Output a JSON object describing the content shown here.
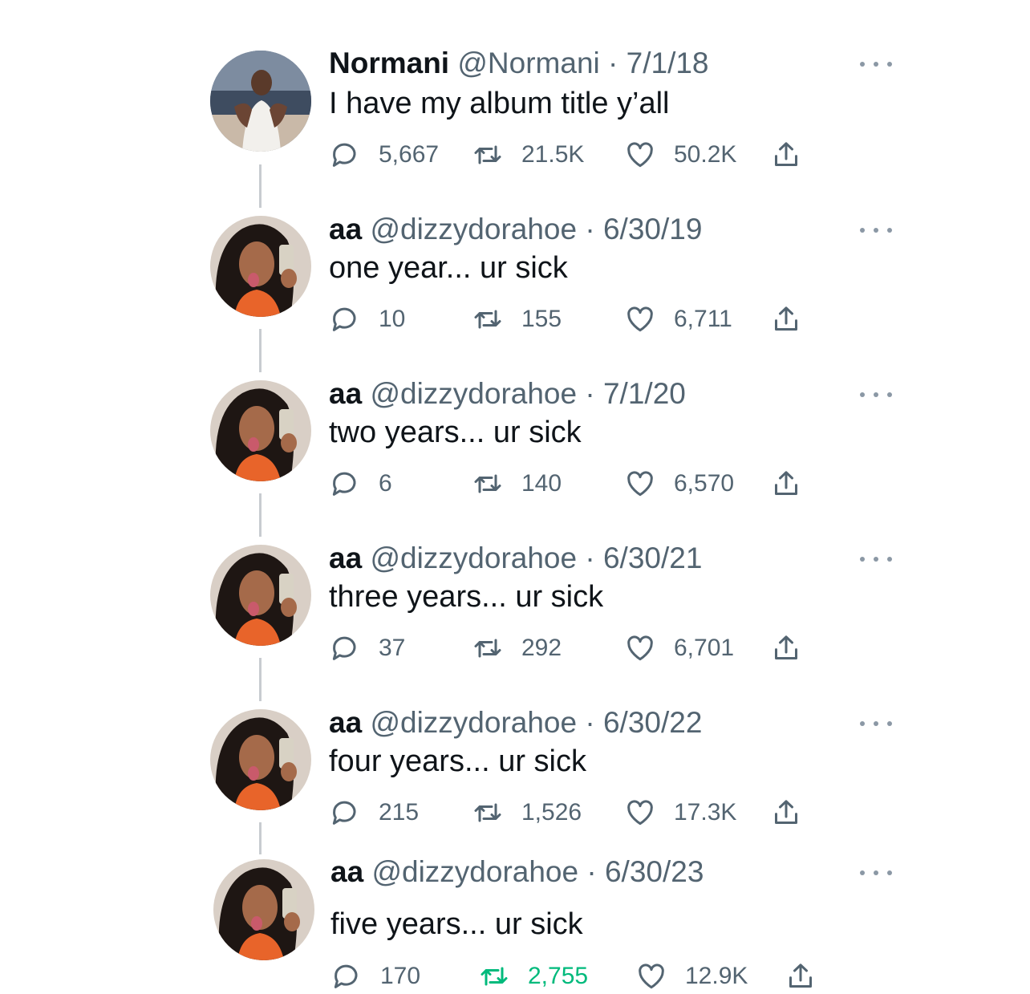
{
  "tweets": [
    {
      "name": "Normani",
      "handle": "@Normani",
      "sep": "·",
      "date": "7/1/18",
      "text": "I have my album title y’all",
      "replies": "5,667",
      "retweets": "21.5K",
      "likes": "50.2K",
      "retweeted": false
    },
    {
      "name": "aa",
      "handle": "@dizzydorahoe",
      "sep": "·",
      "date": "6/30/19",
      "text": "one year... ur sick",
      "replies": "10",
      "retweets": "155",
      "likes": "6,711",
      "retweeted": false
    },
    {
      "name": "aa",
      "handle": "@dizzydorahoe",
      "sep": "·",
      "date": "7/1/20",
      "text": "two years... ur sick",
      "replies": "6",
      "retweets": "140",
      "likes": "6,570",
      "retweeted": false
    },
    {
      "name": "aa",
      "handle": "@dizzydorahoe",
      "sep": "·",
      "date": "6/30/21",
      "text": "three years... ur sick",
      "replies": "37",
      "retweets": "292",
      "likes": "6,701",
      "retweeted": false
    },
    {
      "name": "aa",
      "handle": "@dizzydorahoe",
      "sep": "·",
      "date": "6/30/22",
      "text": "four years... ur sick",
      "replies": "215",
      "retweets": "1,526",
      "likes": "17.3K",
      "retweeted": false
    },
    {
      "name": "aa",
      "handle": "@dizzydorahoe",
      "sep": "·",
      "date": "6/30/23",
      "text": "five years... ur sick",
      "replies": "170",
      "retweets": "2,755",
      "likes": "12.9K",
      "retweeted": true
    }
  ],
  "colors": {
    "text": "#0f1419",
    "muted": "#536471",
    "retweet_active": "#00ba7c",
    "thread_line": "#c8ccd0"
  },
  "icons": {
    "reply": "reply-icon",
    "retweet": "retweet-icon",
    "like": "heart-icon",
    "share": "share-icon",
    "more": "more-icon"
  }
}
